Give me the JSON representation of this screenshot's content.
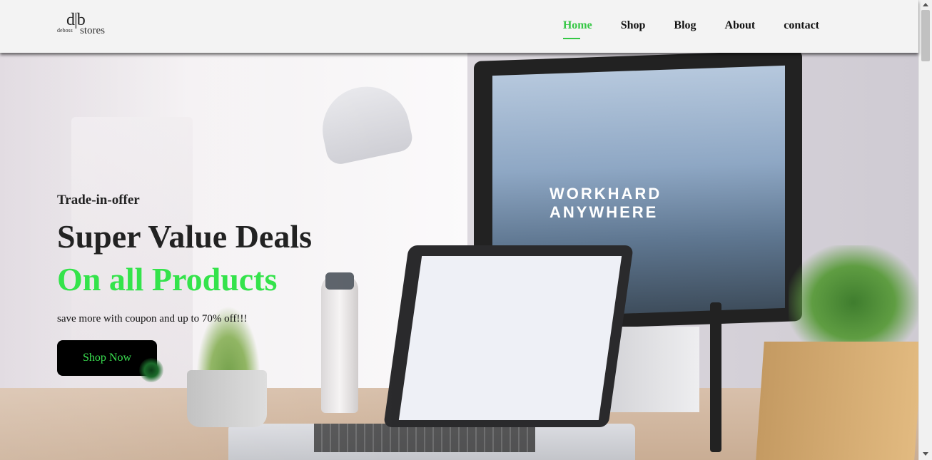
{
  "header": {
    "logo": {
      "big": "d|b",
      "small": "deboss",
      "stores": "stores"
    },
    "nav": [
      {
        "label": "Home",
        "active": true
      },
      {
        "label": "Shop",
        "active": false
      },
      {
        "label": "Blog",
        "active": false
      },
      {
        "label": "About",
        "active": false
      },
      {
        "label": "contact",
        "active": false
      }
    ]
  },
  "hero": {
    "eyebrow": "Trade-in-offer",
    "title": "Super Value Deals",
    "highlight": "On all Products",
    "subtitle": "save more with coupon and up to 70% off!!!",
    "cta_label": "Shop Now",
    "screen_text": "WORKHARD ANYWHERE"
  },
  "colors": {
    "accent": "#34e34b",
    "button_bg": "#000000",
    "header_bg": "#f3f3f3"
  }
}
